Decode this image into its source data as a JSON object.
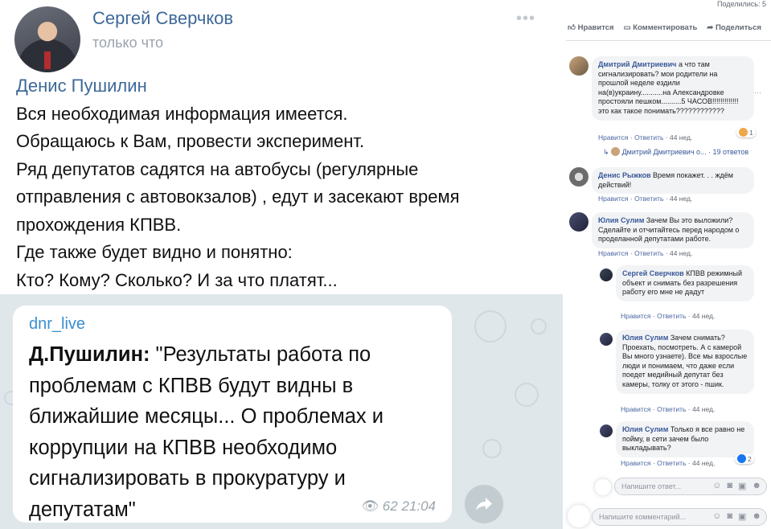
{
  "post": {
    "author": "Сергей Сверчков",
    "time": "только что",
    "more_icon": "•••",
    "mention": "Денис Пушилин",
    "lines": [
      "Вся необходимая информация имеется.",
      "Обращаюсь к Вам, провести эксперимент.",
      "Ряд депутатов садятся на автобусы (регулярные",
      "отправления с автовокзалов) , едут и засекают время",
      "прохождения КПВВ.",
      "Где также будет видно и понятно:",
      "Кто? Кому? Сколько? И за что платят..."
    ]
  },
  "telegram": {
    "channel": "dnr_live",
    "bold_prefix": "Д.Пушилин:",
    "text": " \"Результаты работа по проблемам с КПВВ будут видны в ближайшие месяцы... О проблемах и коррупции на КПВВ необходимо сигнализировать в прокуратуру и депутатам\"",
    "views": "62",
    "time": "21:04"
  },
  "fb": {
    "shares": "Поделились: 5",
    "actions": {
      "like": "Нравится",
      "comment": "Комментировать",
      "share": "Поделиться"
    },
    "comments": [
      {
        "name": "Дмитрий Дмитриевич",
        "text": "а что там сигнализировать? мои родители на прошлой неделе ездили на(в)украину...........на Александровке простояли пешком..........5 ЧАСОВ!!!!!!!!!!!!! это как такое понимать????????????",
        "like": "Нравится",
        "reply": "Ответить",
        "age": "44 нед.",
        "reaction_count": "1"
      },
      {
        "name": "Денис Рыжков",
        "text": "Время покажет. . . ждём действий!",
        "like": "Нравится",
        "reply": "Ответить",
        "age": "44 нед."
      },
      {
        "name": "Юлия Сулим",
        "text": "Зачем Вы это выложили? Сделайте и отчитайтесь перед народом о проделанной депутатами работе.",
        "like": "Нравится",
        "reply": "Ответить",
        "age": "44 нед."
      }
    ],
    "replies_link": "Дмитрий Дмитриевич о... · 19 ответов",
    "replies": [
      {
        "name": "Сергей Сверчков",
        "text": "КПВВ режимный объект и снимать без разрешения работу его мне не дадут",
        "like": "Нравится",
        "reply": "Ответить",
        "age": "44 нед."
      },
      {
        "name": "Юлия Сулим",
        "text": "Зачем снимать? Проехать, посмотреть. А с камерой Вы много узнаете). Все мы взрослые люди и понимаем, что даже если поедет медийный депутат без камеры, толку от этого - пшик.",
        "like": "Нравится",
        "reply": "Ответить",
        "age": "44 нед."
      },
      {
        "name": "Юлия Сулим",
        "text": "Только я все равно не пойму, в сети зачем было выкладывать?",
        "like": "Нравится",
        "reply": "Ответить",
        "age": "44 нед.",
        "reaction_count": "2"
      }
    ],
    "reply_placeholder": "Напишите ответ...",
    "comment_placeholder": "Напишите комментарий..."
  }
}
